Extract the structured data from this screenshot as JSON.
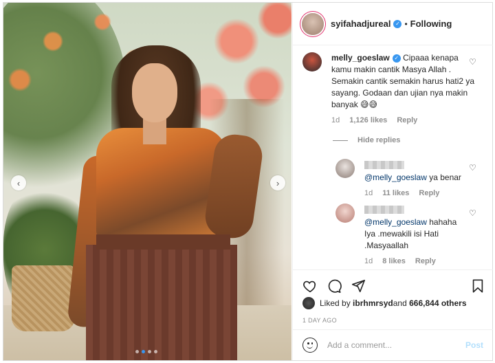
{
  "post": {
    "username": "syifahadjureal",
    "separator": "•",
    "follow_status": "Following"
  },
  "comments": [
    {
      "username": "melly_goeslaw",
      "text": "Cipaaa kenapa kamu makin cantik Masya Allah . Semakin cantik semakin harus hati2 ya sayang. Godaan dan ujian nya makin banyak 😅😅",
      "age": "1d",
      "likes": "1,126 likes",
      "reply_label": "Reply"
    }
  ],
  "hide_replies_label": "Hide replies",
  "replies": [
    {
      "mention": "@melly_goeslaw",
      "text": " ya benar",
      "age": "1d",
      "likes": "11 likes",
      "reply_label": "Reply"
    },
    {
      "mention": "@melly_goeslaw",
      "text": " hahaha Iya .mewakili isi Hati .Masyaallah",
      "age": "1d",
      "likes": "8 likes",
      "reply_label": "Reply"
    }
  ],
  "likes_summary": {
    "prefix": "Liked by ",
    "user": "ibrhmrsyd",
    "middle": " and ",
    "others": "666,844 others"
  },
  "timestamp": "1 DAY AGO",
  "add_comment": {
    "placeholder": "Add a comment...",
    "post_label": "Post"
  },
  "carousel": {
    "total_slides": 4,
    "active_index": 1
  },
  "colors": {
    "accent": "#3897f0",
    "post_disabled": "#b2dffc",
    "text": "#262626",
    "muted": "#8e8e8e"
  },
  "icons": [
    "chevron-left-icon",
    "chevron-right-icon",
    "verified-badge-icon",
    "heart-icon",
    "comment-icon",
    "share-icon",
    "bookmark-icon",
    "emoji-icon"
  ]
}
